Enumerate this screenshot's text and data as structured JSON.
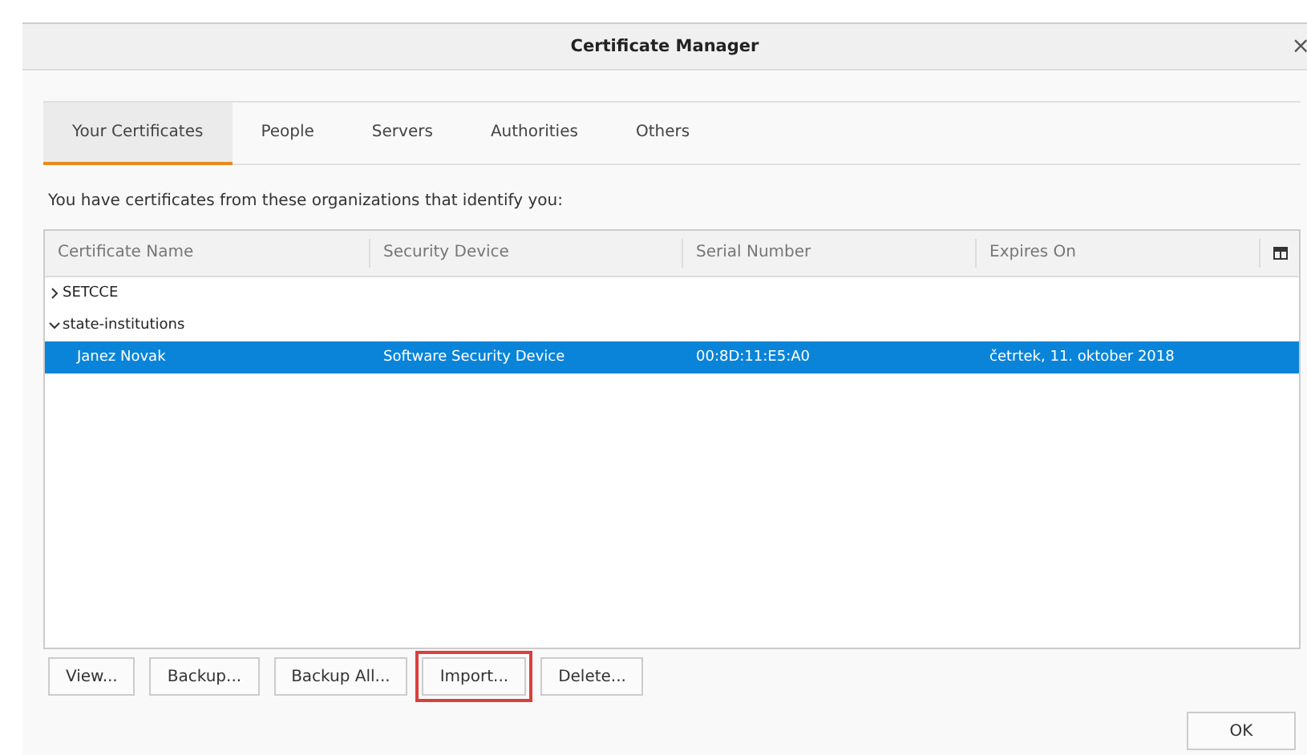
{
  "window": {
    "title": "Certificate Manager",
    "close": "×"
  },
  "tabs": [
    {
      "label": "Your Certificates",
      "selected": true
    },
    {
      "label": "People",
      "selected": false
    },
    {
      "label": "Servers",
      "selected": false
    },
    {
      "label": "Authorities",
      "selected": false
    },
    {
      "label": "Others",
      "selected": false
    }
  ],
  "description": "You have certificates from these organizations that identify you:",
  "table": {
    "columns": [
      "Certificate Name",
      "Security Device",
      "Serial Number",
      "Expires On"
    ],
    "groups": [
      {
        "name": "SETCCE",
        "expanded": false
      },
      {
        "name": "state-institutions",
        "expanded": true,
        "rows": [
          {
            "cells": [
              "Janez Novak",
              "Software Security Device",
              "00:8D:11:E5:A0",
              "četrtek, 11. oktober 2018"
            ],
            "selected": true
          }
        ]
      }
    ]
  },
  "buttons": [
    {
      "label": "View...",
      "highlighted": false
    },
    {
      "label": "Backup...",
      "highlighted": false
    },
    {
      "label": "Backup All...",
      "highlighted": false
    },
    {
      "label": "Import...",
      "highlighted": true
    },
    {
      "label": "Delete...",
      "highlighted": false
    }
  ],
  "ok_button": "OK"
}
